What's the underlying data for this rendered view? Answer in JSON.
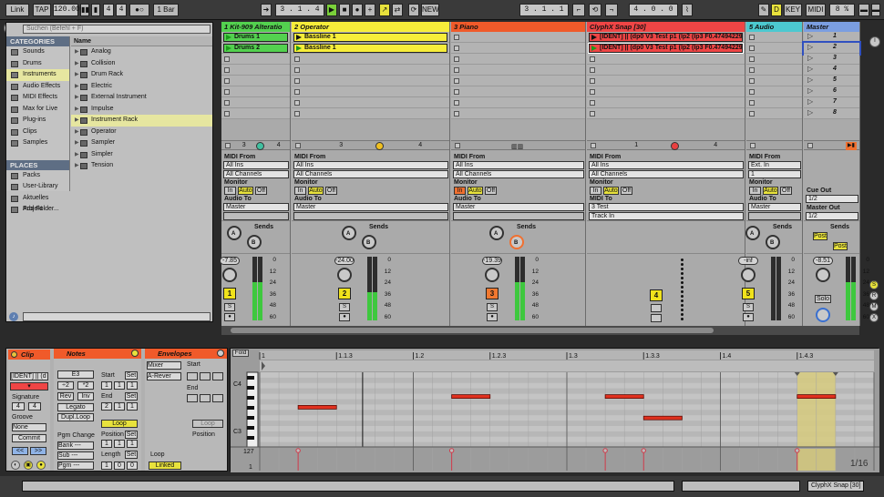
{
  "transport": {
    "link": "Link",
    "tap": "TAP",
    "tempo": "120.00",
    "sig_num": "4",
    "sig_den": "4",
    "quant": "1 Bar",
    "arrangement_pos": "3 .   1 .   4",
    "loop_start": "3 .   1 .   1",
    "loop_length": "4 .   0 .   0",
    "new_label": "NEW",
    "key_label": "KEY",
    "midi_label": "MIDI",
    "cpu": "8 %",
    "record_key": "D"
  },
  "browser": {
    "search_placeholder": "Suchen (Befehl + F)",
    "categories_title": "CATEGORIES",
    "categories": [
      "Sounds",
      "Drums",
      "Instruments",
      "Audio Effects",
      "MIDI Effects",
      "Max for Live",
      "Plug-ins",
      "Clips",
      "Samples"
    ],
    "places_title": "PLACES",
    "places": [
      "Packs",
      "User-Library",
      "Aktuelles Projekt",
      "Add Folder..."
    ],
    "name_header": "Name",
    "items": [
      "Analog",
      "Collision",
      "Drum Rack",
      "Electric",
      "External Instrument",
      "Impulse",
      "Instrument Rack",
      "Operator",
      "Sampler",
      "Simpler",
      "Tension"
    ]
  },
  "tracks": [
    {
      "name": "1 Kit-909 Alteratio",
      "color": "#53d14f",
      "clips": [
        {
          "name": "Drums 1",
          "color": "#53d14f",
          "playing": true
        },
        {
          "name": "Drums 2",
          "color": "#53d14f",
          "playing": true
        }
      ],
      "stop_a": "3",
      "stop_b": "4",
      "midi_from": "All Ins",
      "channel": "All Channels",
      "monitor": [
        "In",
        "Auto",
        "Off"
      ],
      "audio_to_label": "Audio To",
      "audio_to": "Master",
      "sends": "Sends",
      "volume": "-7.85",
      "num": "1",
      "num_color": "#f0e21c"
    },
    {
      "name": "2 Operator",
      "color": "#f7ed3a",
      "clips": [
        {
          "name": "Bassline 1",
          "color": "#f7ed3a",
          "playing": false
        },
        {
          "name": "Bassline 1",
          "color": "#f7ed3a",
          "playing": true
        }
      ],
      "stop_a": "3",
      "stop_b": "4",
      "midi_from": "All Ins",
      "channel": "All Channels",
      "monitor": [
        "In",
        "Auto",
        "Off"
      ],
      "audio_to_label": "Audio To",
      "audio_to": "Master",
      "sends": "Sends",
      "volume": "-24.00",
      "num": "2",
      "num_color": "#f0e21c"
    },
    {
      "name": "3 Piano",
      "color": "#f05a2a",
      "clips": [],
      "stop_a": "",
      "stop_b": "",
      "midi_from": "All Ins",
      "channel": "All Channels",
      "monitor": [
        "In",
        "Auto",
        "Off"
      ],
      "audio_to_label": "Audio To",
      "audio_to": "Master",
      "sends": "Sends",
      "volume": "-19.39",
      "num": "3",
      "num_color": "#f07830"
    },
    {
      "name": "ClyphX Snap [30]",
      "color": "#ef4545",
      "clips": [
        {
          "name": "[IDENT] || (dp0 V3 Test p1 (lp2 (lp3 F0.4749422967433",
          "color": "#ef4545",
          "playing": false
        },
        {
          "name": "[IDENT] || (dp0 V3 Test p1 (lp2 (lp3 F0.4749422967433",
          "color": "#ef4545",
          "playing": true
        }
      ],
      "stop_a": "1",
      "stop_b": "4",
      "midi_from": "All Ins",
      "channel": "All Channels",
      "monitor": [
        "In",
        "Auto",
        "Off"
      ],
      "audio_to_label": "MIDI To",
      "audio_to": "3 Test",
      "audio_to2": "Track In",
      "sends": "",
      "volume": "",
      "num": "4",
      "num_color": "#f0e21c"
    },
    {
      "name": "5 Audio",
      "color": "#4cc9d0",
      "clips": [],
      "stop_a": "",
      "stop_b": "",
      "midi_from": "Ext. In",
      "channel": "1",
      "monitor": [
        "In",
        "Auto",
        "Off"
      ],
      "audio_to_label": "Audio To",
      "audio_to": "Master",
      "sends": "Sends",
      "volume": "-inf",
      "num": "5",
      "num_color": "#f0e21c"
    },
    {
      "name": "Master",
      "color": "#7b9ee0",
      "scenes": [
        "1",
        "2",
        "3",
        "4",
        "5",
        "6",
        "7",
        "8"
      ],
      "cue_out_label": "Cue Out",
      "cue_out": "1/2",
      "master_out_label": "Master Out",
      "master_out": "1/2",
      "sends": "Sends",
      "post": "Post",
      "volume": "-8.51",
      "solo": "Solo"
    }
  ],
  "meter_scale": [
    "0",
    "12",
    "24",
    "36",
    "48",
    "60"
  ],
  "midi_from_label": "MIDI From",
  "monitor_label": "Monitor",
  "detail": {
    "clip_title": "Clip",
    "clip_name": "[IDENT] || (d",
    "signature_label": "Signature",
    "sig_num": "4",
    "sig_den": "4",
    "groove_label": "Groove",
    "groove": "None",
    "commit": "Commit",
    "notes_title": "Notes",
    "note": "E3",
    "div2": "÷2",
    "mul2": "*2",
    "rev": "Rev",
    "inv": "Inv",
    "legato": "Legato",
    "dupl": "Dupl.Loop",
    "pgm_label": "Pgm Change",
    "bank": "Bank ---",
    "sub": "Sub ---",
    "pgm": "Pgm ---",
    "start_label": "Start",
    "end_label": "End",
    "set": "Set",
    "start": [
      "1",
      "1",
      "1"
    ],
    "end": [
      "2",
      "1",
      "1"
    ],
    "loop": "Loop",
    "position_label": "Position",
    "length_label": "Length",
    "position": [
      "1",
      "1",
      "1"
    ],
    "length": [
      "1",
      "0",
      "0"
    ],
    "env_title": "Envelopes",
    "env_dev": "Mixer",
    "env_param": "A-Rever",
    "env_start": "Start",
    "env_end": "End",
    "env_loop": "Loop",
    "env_position": "Position",
    "env_loop_label": "Loop",
    "linked": "Linked"
  },
  "editor": {
    "fold": "Fold",
    "ruler": [
      "1",
      "1.1.3",
      "1.2",
      "1.2.3",
      "1.3",
      "1.3.3",
      "1.4",
      "1.4.3"
    ],
    "key_c4": "C4",
    "key_c3": "C3",
    "vel_top": "127",
    "vel_bottom": "1",
    "grid": "1/16",
    "notes": [
      {
        "beat": 0.25,
        "dur": 0.25,
        "pitch": 0
      },
      {
        "beat": 1.25,
        "dur": 0.25,
        "pitch": 1
      },
      {
        "beat": 2.25,
        "dur": 0.25,
        "pitch": 1
      },
      {
        "beat": 2.5,
        "dur": 0.25,
        "pitch": -1
      },
      {
        "beat": 3.5,
        "dur": 0.25,
        "pitch": 1
      }
    ]
  },
  "status": {
    "track": "ClyphX Snap [30]"
  }
}
